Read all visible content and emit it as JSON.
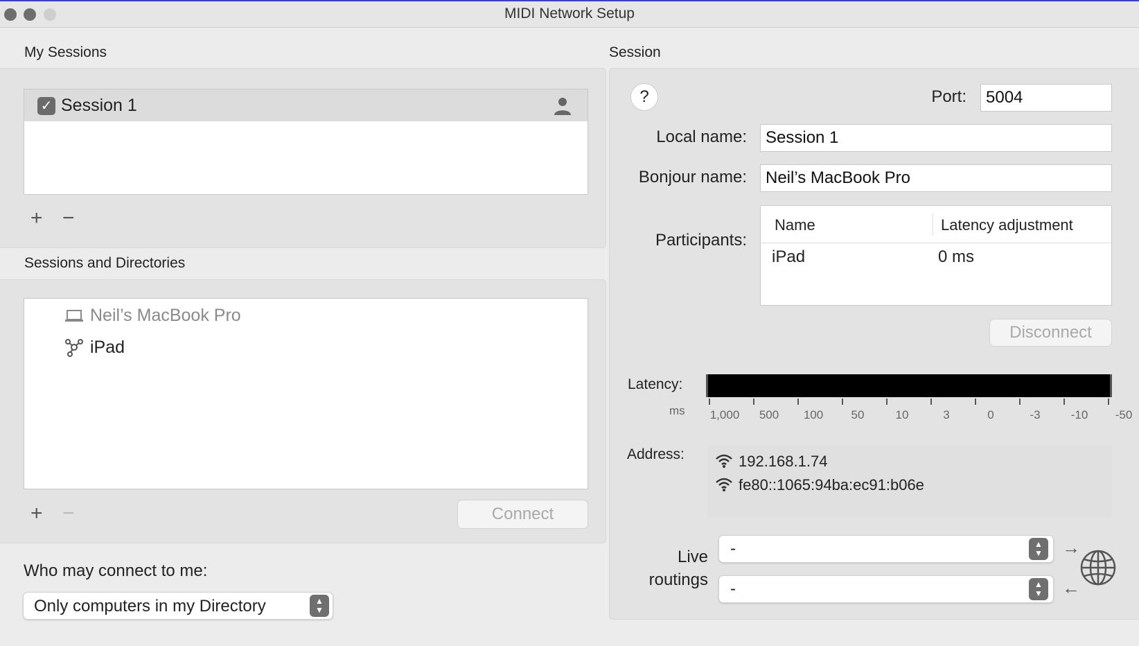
{
  "window": {
    "title": "MIDI Network Setup"
  },
  "my_sessions": {
    "heading": "My Sessions",
    "sessions": [
      {
        "name": "Session 1",
        "enabled": true
      }
    ],
    "add_label": "+",
    "remove_label": "−"
  },
  "directories": {
    "heading": "Sessions and Directories",
    "items": [
      {
        "name": "Neil’s MacBook Pro",
        "icon": "laptop-icon"
      },
      {
        "name": "iPad",
        "icon": "network-icon"
      }
    ],
    "add_label": "+",
    "remove_label": "−",
    "connect_label": "Connect"
  },
  "who_may_connect": {
    "label": "Who may connect to me:",
    "selected": "Only computers in my Directory"
  },
  "session": {
    "heading": "Session",
    "help_label": "?",
    "port_label": "Port:",
    "port_value": "5004",
    "local_name_label": "Local name:",
    "local_name_value": "Session 1",
    "bonjour_name_label": "Bonjour name:",
    "bonjour_name_value": "Neil’s MacBook Pro",
    "participants_label": "Participants:",
    "participants_columns": [
      "Name",
      "Latency adjustment"
    ],
    "participants_rows": [
      {
        "name": "iPad",
        "latency": "0 ms"
      }
    ],
    "disconnect_label": "Disconnect",
    "latency_label": "Latency:",
    "latency_unit": "ms",
    "latency_ticks": [
      "1,000",
      "500",
      "100",
      "50",
      "10",
      "3",
      "0",
      "-3",
      "-10",
      "-50"
    ],
    "address_label": "Address:",
    "addresses": [
      "192.168.1.74",
      "fe80::1065:94ba:ec91:b06e"
    ],
    "live_routings_label_1": "Live",
    "live_routings_label_2": "routings",
    "routing_out_value": "-",
    "routing_in_value": "-",
    "arrow_out": "→",
    "arrow_in": "←"
  },
  "colors": {
    "window_bg": "#ececec",
    "latency_bar": "#000000",
    "checkbox": "#6b6b6b"
  }
}
